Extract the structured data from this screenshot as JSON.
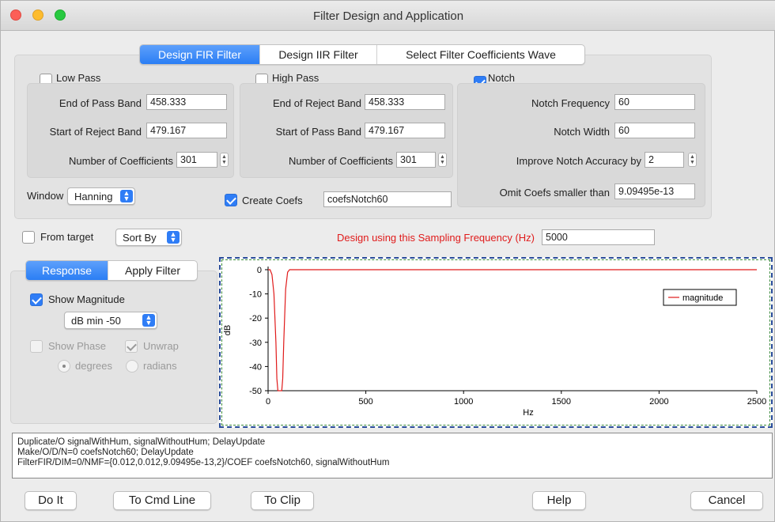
{
  "window": {
    "title": "Filter Design and Application"
  },
  "tabs": [
    {
      "label": "Design FIR Filter",
      "selected": true
    },
    {
      "label": "Design IIR Filter",
      "selected": false
    },
    {
      "label": "Select Filter Coefficients Wave",
      "selected": false
    }
  ],
  "lowpass": {
    "label": "Low Pass",
    "checked": false,
    "end_pass_label": "End of Pass Band",
    "end_pass_value": "458.333",
    "start_reject_label": "Start of Reject Band",
    "start_reject_value": "479.167",
    "ncoef_label": "Number of Coefficients",
    "ncoef_value": "301"
  },
  "highpass": {
    "label": "High Pass",
    "checked": false,
    "end_reject_label": "End of Reject Band",
    "end_reject_value": "458.333",
    "start_pass_label": "Start of Pass Band",
    "start_pass_value": "479.167",
    "ncoef_label": "Number of Coefficients",
    "ncoef_value": "301"
  },
  "notch": {
    "label": "Notch",
    "checked": true,
    "freq_label": "Notch Frequency",
    "freq_value": "60",
    "width_label": "Notch Width",
    "width_value": "60",
    "accuracy_label": "Improve Notch Accuracy by",
    "accuracy_value": "2",
    "omit_label": "Omit Coefs smaller than",
    "omit_value": "9.09495e-13"
  },
  "window_select": {
    "label": "Window",
    "value": "Hanning"
  },
  "create_coefs": {
    "label": "Create Coefs",
    "checked": true,
    "value": "coefsNotch60"
  },
  "from_target": {
    "label": "From target",
    "checked": false
  },
  "sort_by": {
    "value": "Sort By"
  },
  "sampling": {
    "label": "Design using this Sampling Frequency (Hz)",
    "value": "5000",
    "label_color": "#e01b1b"
  },
  "response_tabs": [
    {
      "label": "Response",
      "selected": true
    },
    {
      "label": "Apply Filter",
      "selected": false
    }
  ],
  "response": {
    "show_magnitude_label": "Show Magnitude",
    "show_magnitude_checked": true,
    "db_min_value": "dB min -50",
    "show_phase_label": "Show Phase",
    "show_phase_checked": false,
    "unwrap_label": "Unwrap",
    "unwrap_checked": true,
    "degrees_label": "degrees",
    "degrees_selected": true,
    "radians_label": "radians",
    "radians_selected": false
  },
  "chart_data": {
    "type": "line",
    "xlabel": "Hz",
    "ylabel": "dB",
    "xlim": [
      0,
      2500
    ],
    "ylim": [
      -50,
      0
    ],
    "xticks": [
      0,
      500,
      1000,
      1500,
      2000,
      2500
    ],
    "yticks": [
      0,
      -10,
      -20,
      -30,
      -40,
      -50
    ],
    "legend": {
      "position": "top-right"
    },
    "series": [
      {
        "name": "magnitude",
        "color": "#e01b1b",
        "x": [
          0,
          10,
          20,
          30,
          40,
          45,
          50,
          55,
          60,
          65,
          70,
          75,
          80,
          90,
          100,
          110,
          120,
          2500
        ],
        "y": [
          0,
          0,
          -2,
          -10,
          -30,
          -45,
          -50,
          -50,
          -50,
          -50,
          -50,
          -45,
          -30,
          -8,
          -1,
          0,
          0,
          0
        ]
      }
    ]
  },
  "commands": [
    "Duplicate/O signalWithHum, signalWithoutHum; DelayUpdate",
    "Make/O/D/N=0 coefsNotch60; DelayUpdate",
    "FilterFIR/DIM=0/NMF={0.012,0.012,9.09495e-13,2}/COEF coefsNotch60, signalWithoutHum"
  ],
  "buttons": {
    "do_it": "Do It",
    "to_cmd_line": "To Cmd Line",
    "to_clip": "To Clip",
    "help": "Help",
    "cancel": "Cancel"
  }
}
